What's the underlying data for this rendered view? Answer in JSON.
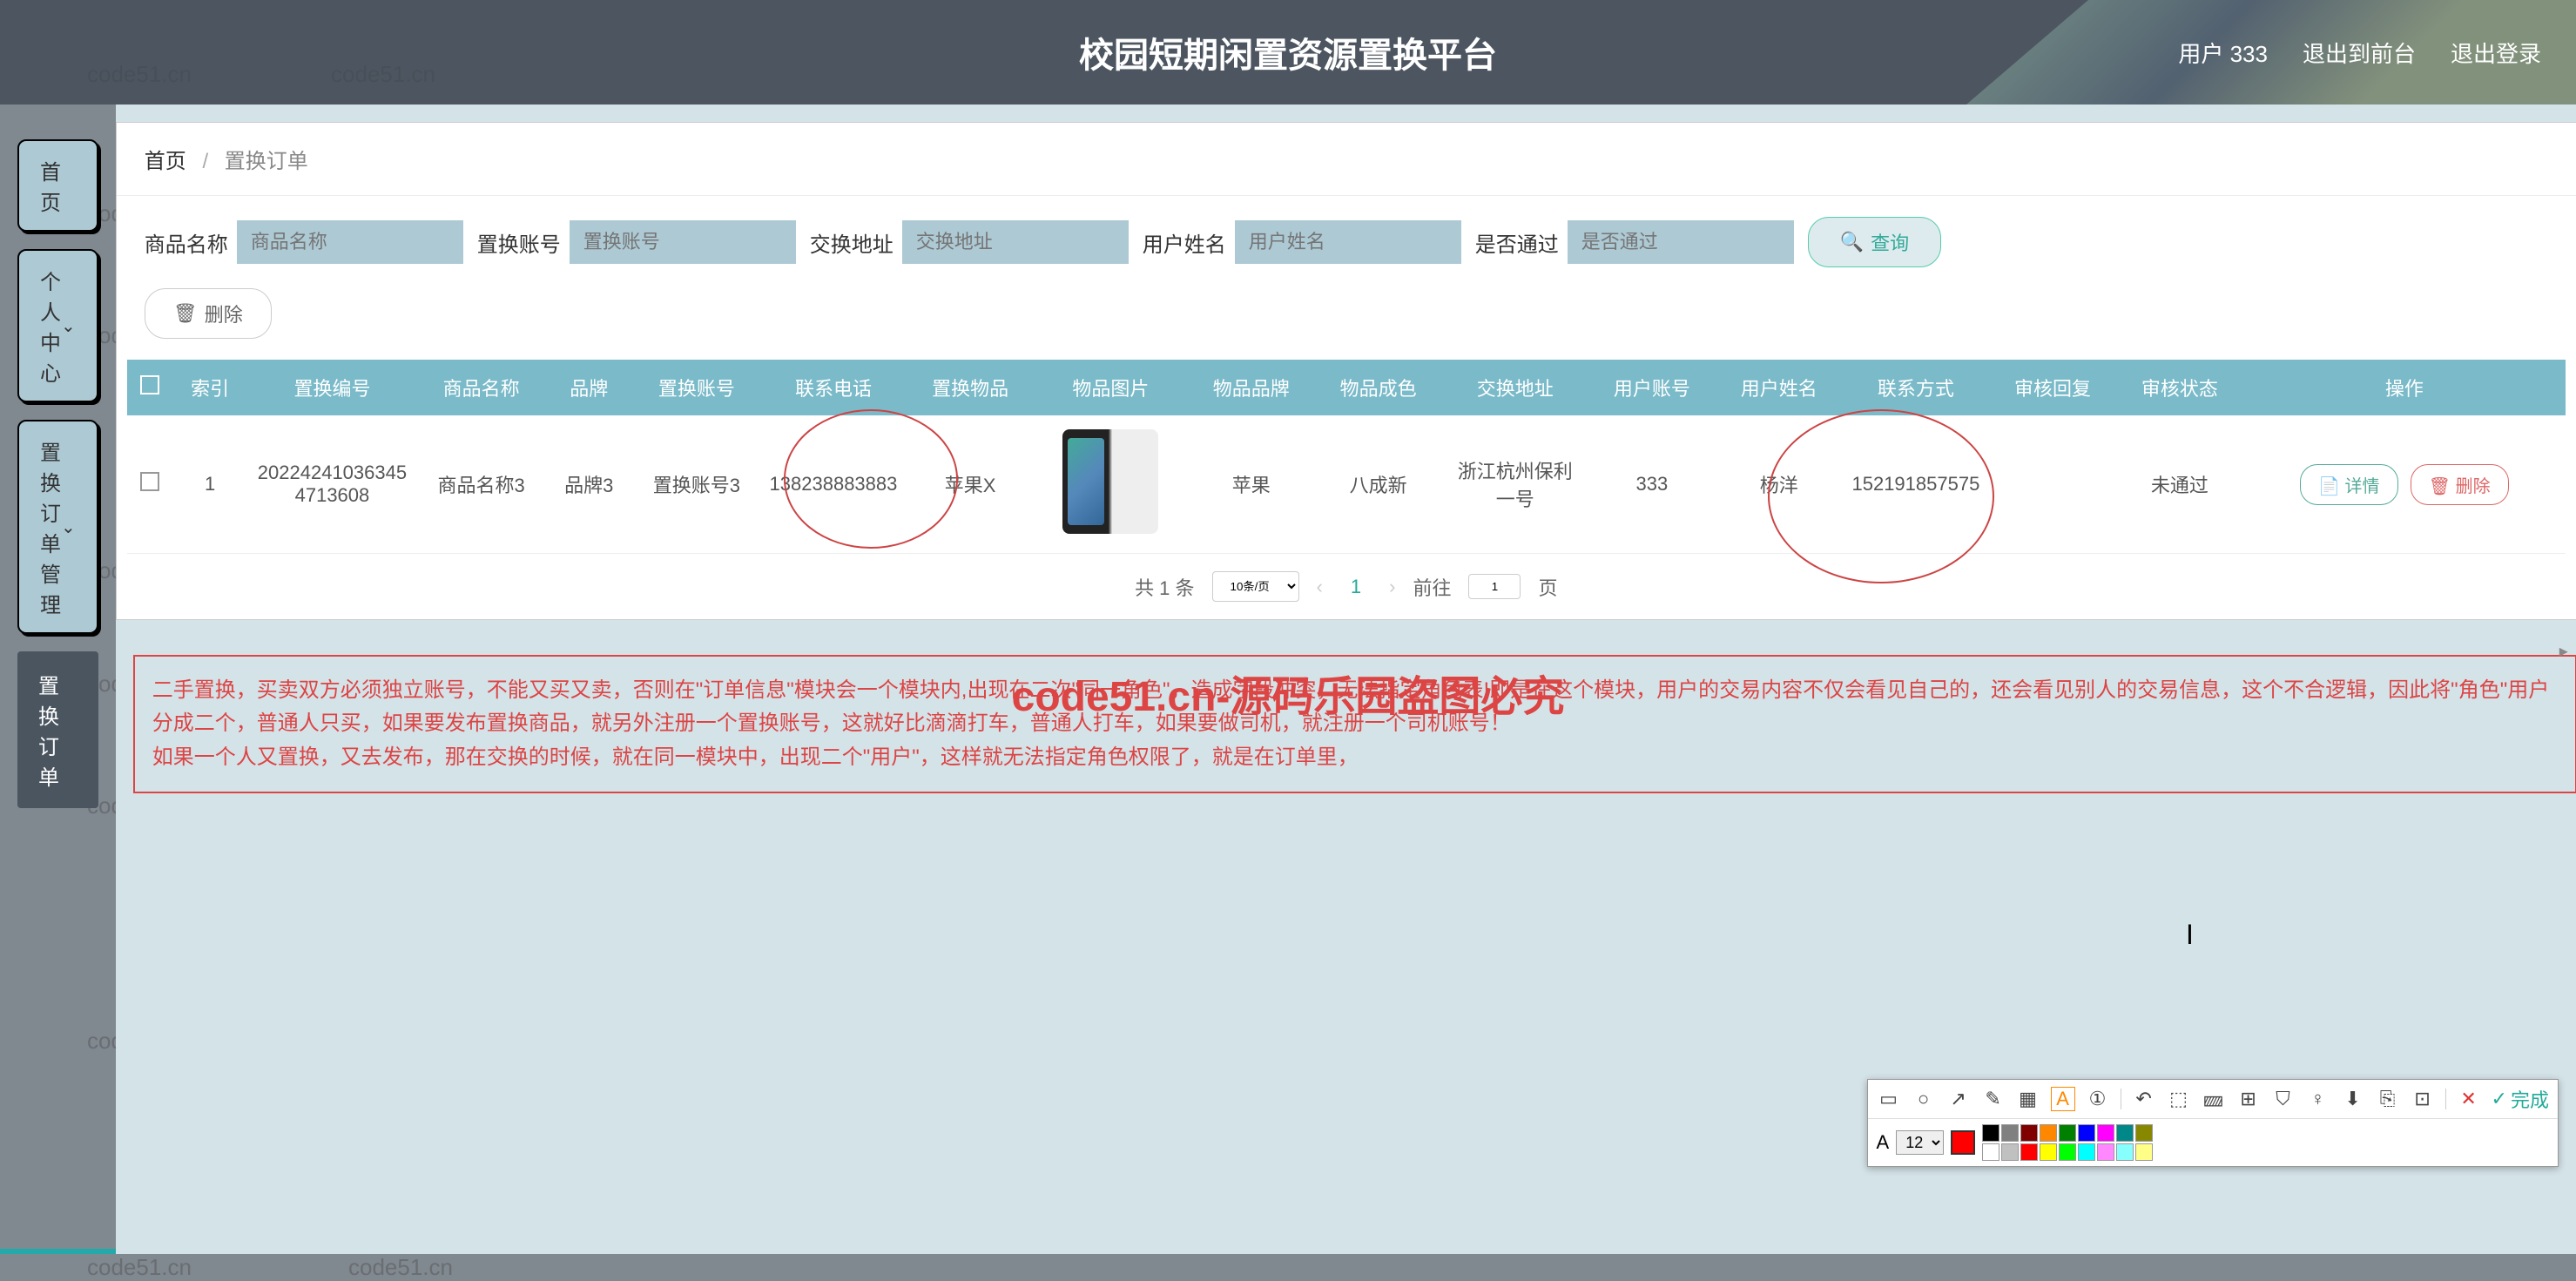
{
  "header": {
    "title": "校园短期闲置资源置换平台",
    "user_label": "用户 333",
    "logout_front": "退出到前台",
    "logout": "退出登录"
  },
  "sidebar": {
    "home": "首页",
    "personal": "个人中心",
    "order_mgmt": "置换订单管理",
    "order": "置换订单"
  },
  "breadcrumb": {
    "home": "首页",
    "current": "置换订单"
  },
  "filters": {
    "product_name": {
      "label": "商品名称",
      "placeholder": "商品名称"
    },
    "exchange_account": {
      "label": "置换账号",
      "placeholder": "置换账号"
    },
    "address": {
      "label": "交换地址",
      "placeholder": "交换地址"
    },
    "user_name": {
      "label": "用户姓名",
      "placeholder": "用户姓名"
    },
    "approved": {
      "label": "是否通过",
      "placeholder": "是否通过"
    },
    "query_btn": "查询"
  },
  "actions": {
    "delete": "删除"
  },
  "table": {
    "headers": [
      "",
      "索引",
      "置换编号",
      "商品名称",
      "品牌",
      "置换账号",
      "联系电话",
      "置换物品",
      "物品图片",
      "物品品牌",
      "物品成色",
      "交换地址",
      "用户账号",
      "用户姓名",
      "联系方式",
      "审核回复",
      "审核状态",
      "操作"
    ],
    "row": {
      "index": "1",
      "order_no": "202242410363454713608",
      "product_name": "商品名称3",
      "brand": "品牌3",
      "exchange_account": "置换账号3",
      "phone": "138238883883",
      "exchange_item": "苹果X",
      "item_brand": "苹果",
      "condition": "八成新",
      "address": "浙江杭州保利一号",
      "user_account": "333",
      "user_name": "杨洋",
      "contact": "152191857575",
      "review_reply": "",
      "review_status": "未通过",
      "btn_detail": "详情",
      "btn_delete": "删除"
    }
  },
  "pagination": {
    "total": "共 1 条",
    "per_page": "10条/页",
    "current": "1",
    "goto": "前往",
    "page_suffix": "页",
    "page_input": "1"
  },
  "notice": {
    "line1": "二手置换，买卖双方必须独立账号，不能又买又卖，否则在\"订单信息\"模块会一个模块内,出现在二次\"同一角色\"，造成字段冲突，无法指定角色表!即是在这个模块，用户的交易内容不仅会看见自己的，还会看见别人的交易信息，这个不合逻辑，因此将\"角色\"用户分成二个，普通人只买，如果要发布置换商品，就另外注册一个置换账号，这就好比滴滴打车，普通人打车，如果要做司机，就注册一个司机账号！",
    "line2": "如果一个人又置换，又去发布，那在交换的时候，就在同一模块中，出现二个\"用户\"，这样就无法指定角色权限了，就是在订单里，"
  },
  "toolbar": {
    "font_label": "A",
    "font_size": "12",
    "done": "完成"
  },
  "colors": [
    "#ff0000",
    "#ff8800",
    "#ffff00",
    "#00ff00",
    "#0088ff",
    "#0000ff",
    "#ff00ff",
    "#ffffff",
    "#880000",
    "#884400",
    "#888800",
    "#008800",
    "#004488",
    "#000088",
    "#880088",
    "#888888",
    "#000000",
    "#444444"
  ],
  "big_watermark": "code51.cn-源码乐园盗图必究"
}
